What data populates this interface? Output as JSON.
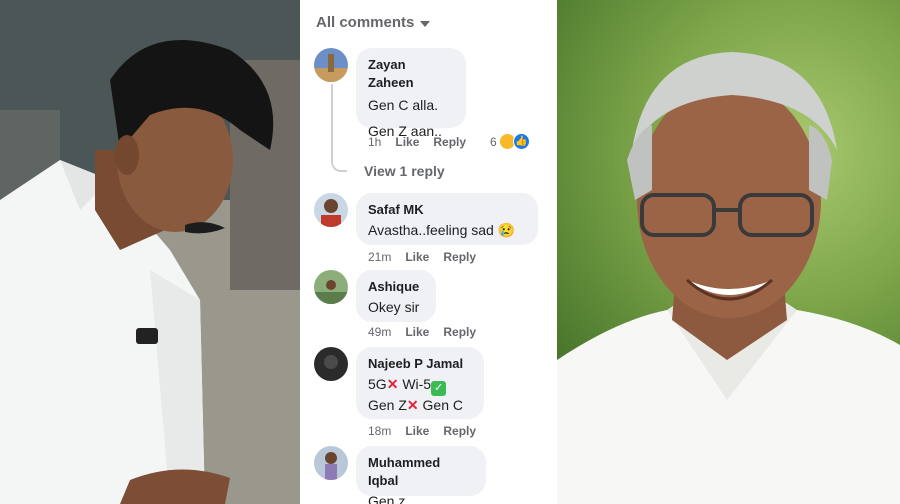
{
  "comments_panel": {
    "header": "All comments",
    "view_reply": "View 1 reply",
    "actions": {
      "like": "Like",
      "reply": "Reply"
    },
    "items": [
      {
        "name": "Zayan Zaheen",
        "lines": [
          "Gen C alla.",
          "Gen Z aan.."
        ],
        "time": "1h",
        "reaction_count": "6"
      },
      {
        "name": "Safaf MK",
        "lines": [
          "Avastha..feeling sad 😢"
        ],
        "time": "21m"
      },
      {
        "name": "Ashique",
        "lines": [
          "Okey sir"
        ],
        "time": "49m"
      },
      {
        "name": "Najeeb P Jamal",
        "line1_a": "5G",
        "line1_b": "Wi-5",
        "line2_a": "Gen Z",
        "line2_b": "Gen C",
        "time": "18m"
      },
      {
        "name": "Muhammed Iqbal",
        "lines": [
          "Gen z"
        ]
      }
    ]
  },
  "colors": {
    "bubble": "#eff1f4",
    "meta_text": "#65676b",
    "like_blue": "#1877f2",
    "haha_yellow": "#f7b928"
  }
}
